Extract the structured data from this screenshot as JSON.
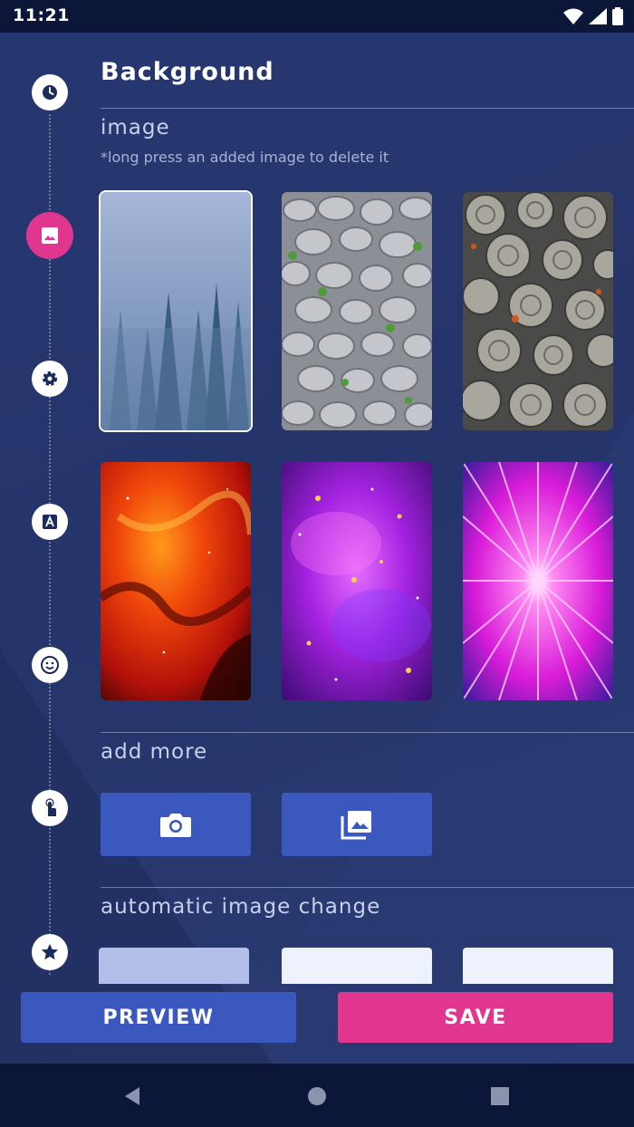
{
  "status_bar": {
    "time": "11:21",
    "icons": [
      "wifi-icon",
      "signal-icon",
      "battery-icon"
    ]
  },
  "header": {
    "title": "Background"
  },
  "timeline": {
    "steps": [
      {
        "icon": "clock-icon",
        "active": false
      },
      {
        "icon": "image-icon",
        "active": true
      },
      {
        "icon": "gear-icon",
        "active": false
      },
      {
        "icon": "text-icon",
        "active": false
      },
      {
        "icon": "smiley-icon",
        "active": false
      },
      {
        "icon": "touch-icon",
        "active": false
      },
      {
        "icon": "star-icon",
        "active": false
      }
    ]
  },
  "image_section": {
    "label": "image",
    "hint": "*long press an added image to delete it",
    "thumbnails": [
      "foggy-forest",
      "pebbles",
      "succulents",
      "red-nebula",
      "purple-galaxy",
      "pink-burst"
    ],
    "selected_index": 0
  },
  "add_more": {
    "label": "add more",
    "buttons": [
      "camera-icon",
      "gallery-icon"
    ]
  },
  "auto_change": {
    "label": "automatic image change"
  },
  "actions": {
    "preview": "PREVIEW",
    "save": "SAVE"
  },
  "colors": {
    "accent": "#e0368f",
    "primary": "#3b58bf",
    "background": "#223062"
  },
  "nav": {
    "icons": [
      "back-icon",
      "home-icon",
      "recents-icon"
    ]
  }
}
